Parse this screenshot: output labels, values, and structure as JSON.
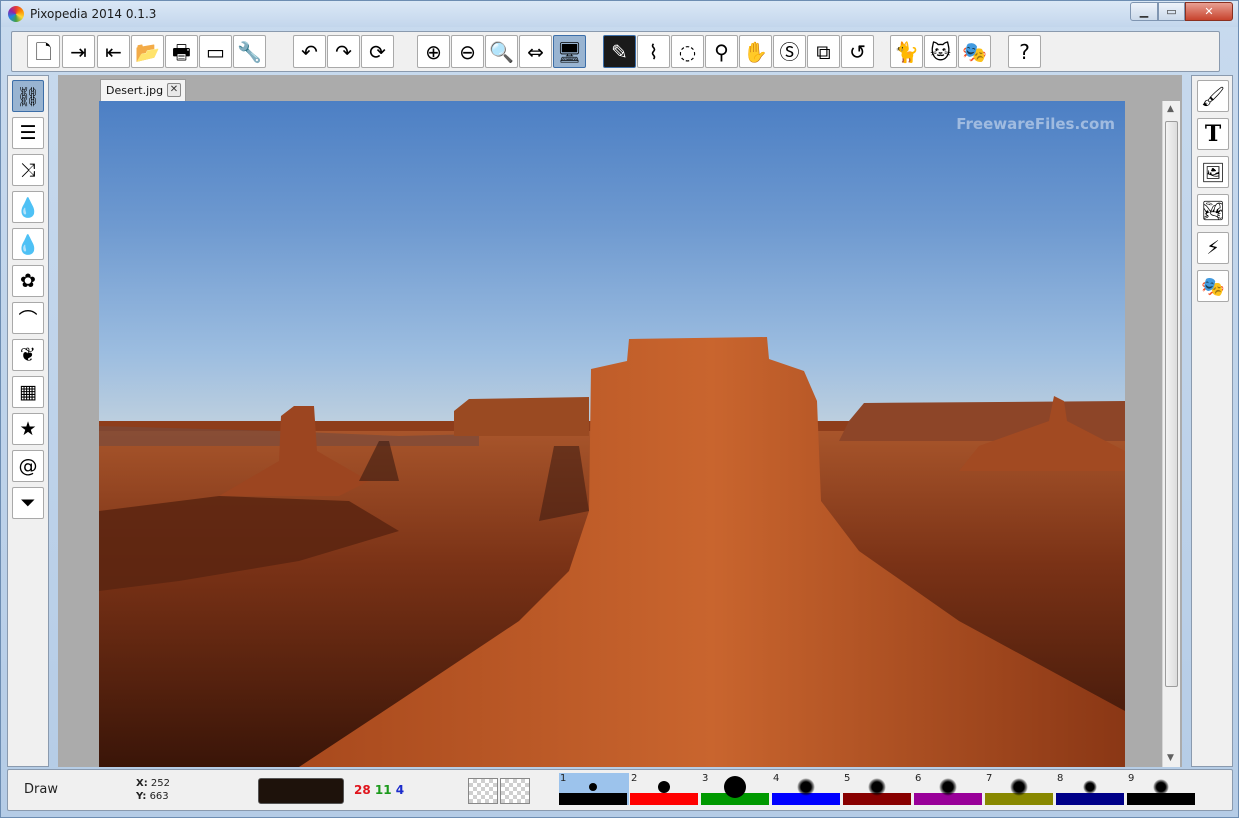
{
  "window": {
    "title": "Pixopedia 2014 0.1.3",
    "min_glyph": "▁",
    "max_glyph": "▭",
    "close_glyph": "✕"
  },
  "toolbar": {
    "buttons": [
      {
        "name": "new-document-icon",
        "glyph": "🗋"
      },
      {
        "name": "import-icon",
        "glyph": "⇥"
      },
      {
        "name": "export-icon",
        "glyph": "⇤"
      },
      {
        "name": "open-folder-icon",
        "glyph": "📂"
      },
      {
        "name": "print-icon",
        "glyph": "🖶"
      },
      {
        "name": "scan-icon",
        "glyph": "▭"
      },
      {
        "name": "settings-wrench-icon",
        "glyph": "🔧"
      },
      {
        "name": "undo-icon",
        "glyph": "↶"
      },
      {
        "name": "redo-icon",
        "glyph": "↷"
      },
      {
        "name": "refresh-icon",
        "glyph": "⟳"
      },
      {
        "name": "zoom-in-icon",
        "glyph": "⊕"
      },
      {
        "name": "zoom-out-icon",
        "glyph": "⊖"
      },
      {
        "name": "zoom-actual-icon",
        "glyph": "🔍"
      },
      {
        "name": "fit-width-icon",
        "glyph": "⇔"
      },
      {
        "name": "fullscreen-monitor-icon",
        "glyph": "🖥"
      },
      {
        "name": "draw-pen-icon",
        "glyph": "✎"
      },
      {
        "name": "path-select-icon",
        "glyph": "⌇"
      },
      {
        "name": "lasso-select-icon",
        "glyph": "◌"
      },
      {
        "name": "eyedropper-icon",
        "glyph": "⚲"
      },
      {
        "name": "hand-pan-icon",
        "glyph": "✋"
      },
      {
        "name": "stamp-search-icon",
        "glyph": "Ⓢ"
      },
      {
        "name": "layers-copy-icon",
        "glyph": "⧉"
      },
      {
        "name": "rotate-icon",
        "glyph": "↺"
      },
      {
        "name": "cat-effect-icon",
        "glyph": "🐈"
      },
      {
        "name": "cat-face-icon",
        "glyph": "🐱"
      },
      {
        "name": "mask-icon",
        "glyph": "🎭"
      },
      {
        "name": "help-icon",
        "glyph": "?"
      }
    ]
  },
  "left_tools": [
    {
      "name": "link-tool-icon",
      "glyph": "⛓"
    },
    {
      "name": "adjust-sliders-icon",
      "glyph": "☰"
    },
    {
      "name": "shuffle-icon",
      "glyph": "⤨"
    },
    {
      "name": "color-drop-settings-icon",
      "glyph": "💧"
    },
    {
      "name": "color-drop-three-icon",
      "glyph": "💧"
    },
    {
      "name": "flower-icon",
      "glyph": "✿"
    },
    {
      "name": "rainbow-icon",
      "glyph": "⌒"
    },
    {
      "name": "leaf-icon",
      "glyph": "❦"
    },
    {
      "name": "grid-calendar-icon",
      "glyph": "▦"
    },
    {
      "name": "magic-wand-star-icon",
      "glyph": "★"
    },
    {
      "name": "spiral-icon",
      "glyph": "@"
    },
    {
      "name": "filter-funnel-icon",
      "glyph": "⏷"
    }
  ],
  "right_tools": [
    {
      "name": "brush-icon",
      "glyph": "🖌"
    },
    {
      "name": "text-tool-icon",
      "glyph": "T"
    },
    {
      "name": "image-frame-icon",
      "glyph": "🖼"
    },
    {
      "name": "picture-icon",
      "glyph": "🏞"
    },
    {
      "name": "plugin-icon",
      "glyph": "⚡"
    },
    {
      "name": "theater-masks-icon",
      "glyph": "🎭"
    }
  ],
  "document": {
    "tab_label": "Desert.jpg",
    "tab_close_glyph": "✕",
    "watermark": "FreewareFiles.com"
  },
  "scrollbar": {
    "up_glyph": "▲",
    "down_glyph": "▼"
  },
  "status": {
    "mode": "Draw",
    "x_label": "X:",
    "x_value": "252",
    "y_label": "Y:",
    "y_value": "663",
    "swatch_color": "#1e120b",
    "r": "28",
    "g": "11",
    "b": "4",
    "r_color": "#e0141c",
    "g_color": "#1c9a1c",
    "b_color": "#1c2ccc"
  },
  "brushes": [
    {
      "num": "1",
      "bar_color": "#000000",
      "selected": true
    },
    {
      "num": "2",
      "bar_color": "#ff0000",
      "selected": false
    },
    {
      "num": "3",
      "bar_color": "#009900",
      "selected": false
    },
    {
      "num": "4",
      "bar_color": "#0000ff",
      "selected": false
    },
    {
      "num": "5",
      "bar_color": "#880000",
      "selected": false
    },
    {
      "num": "6",
      "bar_color": "#990099",
      "selected": false
    },
    {
      "num": "7",
      "bar_color": "#888800",
      "selected": false
    },
    {
      "num": "8",
      "bar_color": "#000088",
      "selected": false
    },
    {
      "num": "9",
      "bar_color": "#000000",
      "selected": false
    }
  ]
}
